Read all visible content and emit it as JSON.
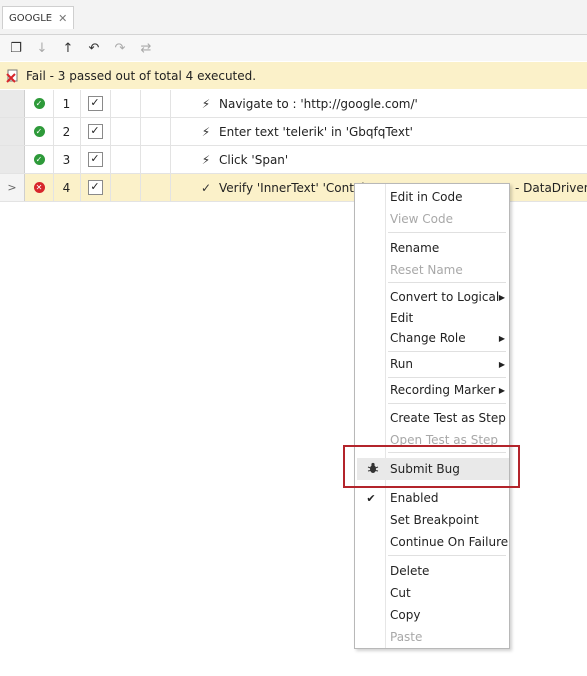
{
  "tab": {
    "label": "GOOGLE",
    "close": "✕"
  },
  "toolbar": {
    "icons": [
      {
        "name": "new-window-icon",
        "glyph": "❐",
        "enabled": true
      },
      {
        "name": "move-down-icon",
        "glyph": "↓",
        "enabled": false
      },
      {
        "name": "move-up-icon",
        "glyph": "↑",
        "enabled": true
      },
      {
        "name": "undo-icon",
        "glyph": "↶",
        "enabled": true
      },
      {
        "name": "redo-icon",
        "glyph": "↷",
        "enabled": false
      },
      {
        "name": "swap-icon",
        "glyph": "⇄",
        "enabled": false
      }
    ]
  },
  "status": {
    "text": "Fail - 3 passed out of total 4 executed.",
    "color": "#fbf1c9"
  },
  "steps": [
    {
      "num": "1",
      "result": "pass",
      "enabled": true,
      "type_icon": "bolt-icon",
      "glyph": "⚡",
      "description": "Navigate to : 'http://google.com/'"
    },
    {
      "num": "2",
      "result": "pass",
      "enabled": true,
      "type_icon": "bolt-icon",
      "glyph": "⚡",
      "description": "Enter text 'telerik' in 'GbqfqText'"
    },
    {
      "num": "3",
      "result": "pass",
      "enabled": true,
      "type_icon": "bolt-icon",
      "glyph": "⚡",
      "description": "Click 'Span'"
    },
    {
      "num": "4",
      "result": "fail",
      "enabled": true,
      "type_icon": "verify-check-icon",
      "glyph": "✓",
      "description": "Verify 'InnerText' 'Contain",
      "extra": "- DataDriven:",
      "selected": true,
      "pointer": ">"
    }
  ],
  "context_menu": {
    "items": [
      {
        "label": "Edit in Code",
        "enabled": true,
        "name": "menu-edit-in-code"
      },
      {
        "label": "View Code",
        "enabled": false,
        "name": "menu-view-code"
      },
      {
        "label": "Rename",
        "enabled": true,
        "name": "menu-rename"
      },
      {
        "label": "Reset Name",
        "enabled": false,
        "name": "menu-reset-name"
      },
      {
        "label": "Convert to Logical",
        "enabled": true,
        "submenu": true,
        "name": "menu-convert-to-logical"
      },
      {
        "label": "Edit",
        "enabled": true,
        "name": "menu-edit"
      },
      {
        "label": "Change Role",
        "enabled": true,
        "submenu": true,
        "name": "menu-change-role"
      },
      {
        "label": "Run",
        "enabled": true,
        "submenu": true,
        "name": "menu-run"
      },
      {
        "label": "Recording Marker",
        "enabled": true,
        "submenu": true,
        "name": "menu-recording-marker"
      },
      {
        "label": "Create Test as Step",
        "enabled": true,
        "name": "menu-create-test-as-step"
      },
      {
        "label": "Open Test as Step",
        "enabled": false,
        "name": "menu-open-test-as-step"
      },
      {
        "label": "Submit Bug",
        "enabled": true,
        "highlighted": true,
        "icon": "bug-icon",
        "name": "menu-submit-bug"
      },
      {
        "label": "Enabled",
        "enabled": true,
        "checked": true,
        "name": "menu-enabled"
      },
      {
        "label": "Set Breakpoint",
        "enabled": true,
        "name": "menu-set-breakpoint"
      },
      {
        "label": "Continue On Failure",
        "enabled": true,
        "name": "menu-continue-on-failure"
      },
      {
        "label": "Delete",
        "enabled": true,
        "name": "menu-delete"
      },
      {
        "label": "Cut",
        "enabled": true,
        "name": "menu-cut"
      },
      {
        "label": "Copy",
        "enabled": true,
        "name": "menu-copy"
      },
      {
        "label": "Paste",
        "enabled": false,
        "name": "menu-paste"
      }
    ]
  },
  "colors": {
    "pass": "#2e9a3a",
    "fail": "#d7262b",
    "highlight_box": "#b3242b"
  }
}
